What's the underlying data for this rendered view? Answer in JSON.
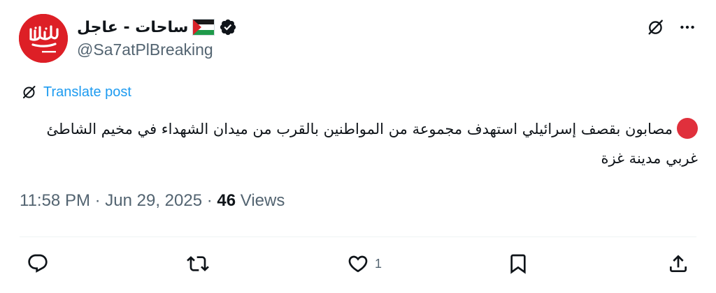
{
  "author": {
    "display_name": "ساحات - عاجل",
    "handle": "@Sa7atPlBreaking",
    "flag_icon": "palestine-flag-icon",
    "verified_icon": "verified-badge-icon",
    "avatar_text": "ساحات"
  },
  "translate": {
    "label": "Translate post"
  },
  "post": {
    "text": "مصابون بقصف إسرائيلي استهدف مجموعة من المواطنين بالقرب من ميدان الشهداء في مخيم الشاطئ غربي مدينة غزة",
    "bullet_icon": "red-circle-icon"
  },
  "meta": {
    "time": "11:58 PM",
    "separator": " · ",
    "date": "Jun 29, 2025",
    "separator2": " · ",
    "views_count": "46",
    "views_label": " Views"
  },
  "actions": {
    "reply_count": "",
    "repost_count": "",
    "like_count": "1",
    "bookmark_count": ""
  },
  "colors": {
    "accent": "#1d9bf0",
    "secondary_text": "#536471",
    "avatar_bg": "#dd1f26",
    "bullet": "#e0303c"
  }
}
